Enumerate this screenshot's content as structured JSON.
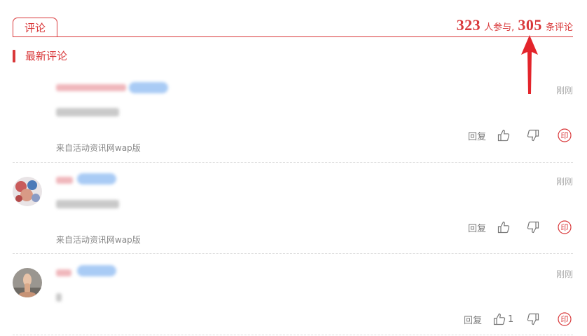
{
  "header": {
    "tab_label": "评论",
    "participants": "323",
    "participants_suffix": "人参与,",
    "comments_count": "305",
    "comments_suffix": "条评论"
  },
  "section": {
    "title": "最新评论"
  },
  "comments": [
    {
      "time": "刚刚",
      "source": "来自活动资讯网wap版",
      "reply_label": "回复",
      "likes": ""
    },
    {
      "time": "刚刚",
      "source": "来自活动资讯网wap版",
      "reply_label": "回复",
      "likes": ""
    },
    {
      "time": "刚刚",
      "source": "",
      "reply_label": "回复",
      "likes": "1"
    }
  ],
  "colors": {
    "accent": "#d9383a",
    "muted": "#888888",
    "blurred_blue": "#8cb8f0"
  },
  "icons": [
    "thumbs-up-icon",
    "thumbs-down-icon",
    "report-stamp-icon",
    "up-arrow-annotation"
  ]
}
